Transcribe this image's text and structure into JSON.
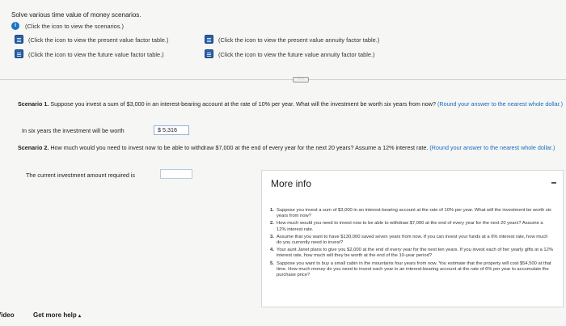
{
  "question_title": "Solve various time value of money scenarios.",
  "links": {
    "scenarios": "(Click the icon to view the scenarios.)",
    "pv_factor": "(Click the icon to view the present value factor table.)",
    "fv_factor": "(Click the icon to view the future value factor table.)",
    "pv_annuity": "(Click the icon to view the present value annuity factor table.)",
    "fv_annuity": "(Click the icon to view the future value annuity factor table.)"
  },
  "expand_label": "·····",
  "scenario1": {
    "label": "Scenario 1.",
    "text": " Suppose you invest a sum of $3,000 in an interest-bearing account at the rate of 10% per year. What will the investment be worth six years from now?",
    "hint": " (Round your answer to the nearest whole dollar.)",
    "answer_prompt": "In six years the investment will be worth",
    "answer_value": "$  5,316"
  },
  "scenario2": {
    "label": "Scenario 2.",
    "text": " How much would you need to invest now to be able to withdraw $7,000 at the end of every year for the next 20 years? Assume a 12% interest rate.",
    "hint": " (Round your answer to the nearest whole dollar.)",
    "answer_prompt": "The current investment amount required is"
  },
  "more_info": {
    "title": "More info",
    "items": [
      {
        "num": "1.",
        "text": "Suppose you invest a sum of $3,000 in an interest-bearing account at the rate of 10% per year. What will the investment be worth six years from now?"
      },
      {
        "num": "2.",
        "text": "How much would you need to invest now to be able to withdraw $7,000 at the end of every year for the next 20 years? Assume a 12% interest rate."
      },
      {
        "num": "3.",
        "text": "Assume that you want to have $130,000 saved seven years from now. If you can invest your funds at a 6% interest rate, how much do you currently need to invest?"
      },
      {
        "num": "4.",
        "text": "Your aunt Janet plans to give you $2,000 at the end of every year for the next ten years. If you invest each of her yearly gifts at a 12% interest rate, how much will they be worth at the end of the 10-year period?"
      },
      {
        "num": "5.",
        "text": "Suppose you want to buy a small cabin in the mountains four years from now. You estimate that the property will cost $54,500 at that time. How much money do you need to invest each year in an interest-bearing account at the rate of 6% per year to accumulate the purchase price?"
      }
    ]
  },
  "bottom": {
    "video_label": "Video",
    "help_label": "Get more help",
    "help_arrow": "▴"
  },
  "icons": {
    "info": "info-icon",
    "table": "table-icon"
  },
  "colors": {
    "accent": "#1a73c8",
    "hint": "#1a6bbf"
  }
}
